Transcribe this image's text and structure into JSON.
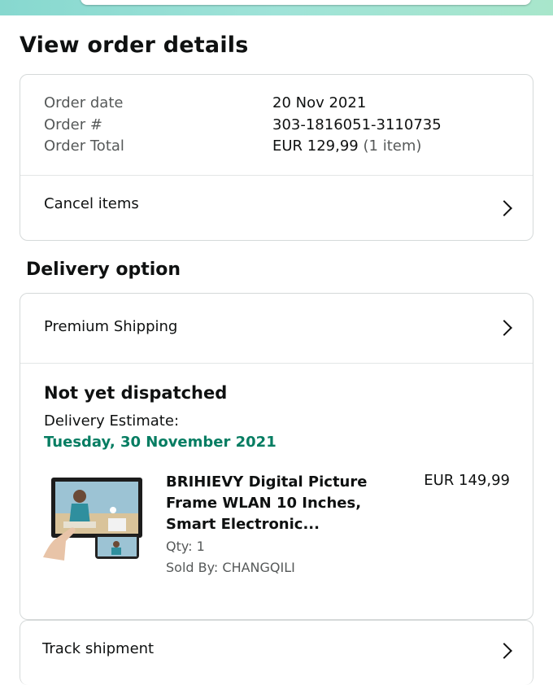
{
  "page": {
    "title": "View order details"
  },
  "summary": {
    "order_date_label": "Order date",
    "order_date": "20 Nov 2021",
    "order_number_label": "Order #",
    "order_number": "303-1816051-3110735",
    "order_total_label": "Order Total",
    "order_total": "EUR 129,99",
    "item_count": "(1 item)",
    "cancel_label": "Cancel items"
  },
  "delivery": {
    "heading": "Delivery option",
    "option": "Premium Shipping",
    "status": "Not yet dispatched",
    "estimate_label": "Delivery Estimate:",
    "estimate_date": "Tuesday, 30 November 2021",
    "estimate_color": "#067d62"
  },
  "product": {
    "title_line1": "BRIHIEVY Digital Picture",
    "title_line2": "Frame WLAN 10 Inches,",
    "title_line3": "Smart Electronic...",
    "price": "EUR 149,99",
    "qty": "Qty: 1",
    "sold_by": "Sold By: CHANGQILI"
  },
  "track": {
    "label": "Track shipment"
  },
  "icons": {
    "chevron": "chevron-right-icon",
    "thumbnail": "digital-picture-frame-image"
  }
}
